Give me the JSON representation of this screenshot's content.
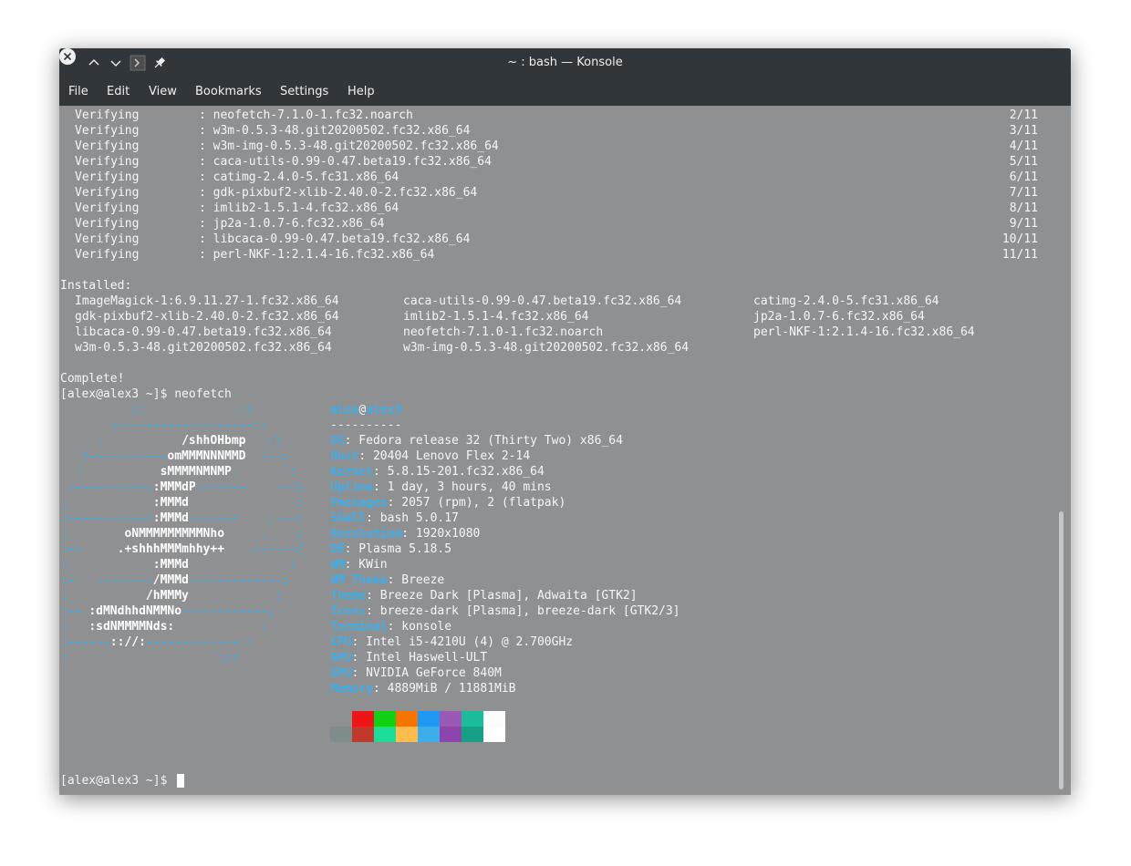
{
  "window": {
    "title": "~ : bash — Konsole"
  },
  "titlebar_icons": [
    "close-icon",
    "minimize-icon",
    "maximize-icon",
    "konsole-app-icon",
    "pin-icon"
  ],
  "menu": [
    "File",
    "Edit",
    "View",
    "Bookmarks",
    "Settings",
    "Help"
  ],
  "verifying": [
    {
      "label": "Verifying",
      "pkg": ": neofetch-7.1.0-1.fc32.noarch",
      "count": "2/11"
    },
    {
      "label": "Verifying",
      "pkg": ": w3m-0.5.3-48.git20200502.fc32.x86_64",
      "count": "3/11"
    },
    {
      "label": "Verifying",
      "pkg": ": w3m-img-0.5.3-48.git20200502.fc32.x86_64",
      "count": "4/11"
    },
    {
      "label": "Verifying",
      "pkg": ": caca-utils-0.99-0.47.beta19.fc32.x86_64",
      "count": "5/11"
    },
    {
      "label": "Verifying",
      "pkg": ": catimg-2.4.0-5.fc31.x86_64",
      "count": "6/11"
    },
    {
      "label": "Verifying",
      "pkg": ": gdk-pixbuf2-xlib-2.40.0-2.fc32.x86_64",
      "count": "7/11"
    },
    {
      "label": "Verifying",
      "pkg": ": imlib2-1.5.1-4.fc32.x86_64",
      "count": "8/11"
    },
    {
      "label": "Verifying",
      "pkg": ": jp2a-1.0.7-6.fc32.x86_64",
      "count": "9/11"
    },
    {
      "label": "Verifying",
      "pkg": ": libcaca-0.99-0.47.beta19.fc32.x86_64",
      "count": "10/11"
    },
    {
      "label": "Verifying",
      "pkg": ": perl-NKF-1:2.1.4-16.fc32.x86_64",
      "count": "11/11"
    }
  ],
  "installed_header": "Installed:",
  "installed": [
    [
      "ImageMagick-1:6.9.11.27-1.fc32.x86_64",
      "caca-utils-0.99-0.47.beta19.fc32.x86_64",
      "catimg-2.4.0-5.fc31.x86_64"
    ],
    [
      "gdk-pixbuf2-xlib-2.40.0-2.fc32.x86_64",
      "imlib2-1.5.1-4.fc32.x86_64",
      "jp2a-1.0.7-6.fc32.x86_64"
    ],
    [
      "libcaca-0.99-0.47.beta19.fc32.x86_64",
      "neofetch-7.1.0-1.fc32.noarch",
      "perl-NKF-1:2.1.4-16.fc32.x86_64"
    ],
    [
      "w3m-0.5.3-48.git20200502.fc32.x86_64",
      "w3m-img-0.5.3-48.git20200502.fc32.x86_64",
      ""
    ]
  ],
  "complete": "Complete!",
  "prompt1": "[alex@alex3 ~]$ neofetch",
  "logo": [
    [
      [
        "f",
        "          /:-------------:\\"
      ]
    ],
    [
      [
        "f",
        "       :-------------------::"
      ]
    ],
    [
      [
        "f",
        "     :-----------"
      ],
      [
        "w",
        "/shhOHbmp"
      ],
      [
        "f",
        "---:\\"
      ]
    ],
    [
      [
        "f",
        "   /-----------"
      ],
      [
        "w",
        "omMMMNNNMMD"
      ],
      [
        "f",
        "  ---:"
      ]
    ],
    [
      [
        "f",
        "  :-----------"
      ],
      [
        "w",
        "sMMMMNMNMP"
      ],
      [
        "f",
        ".    ---:"
      ]
    ],
    [
      [
        "f",
        " :-----------"
      ],
      [
        "w",
        ":MMMdP"
      ],
      [
        "f",
        "-------    ---\\"
      ]
    ],
    [
      [
        "f",
        ",------------"
      ],
      [
        "w",
        ":MMMd"
      ],
      [
        "f",
        "--------    ---:"
      ]
    ],
    [
      [
        "f",
        ":------------"
      ],
      [
        "w",
        ":MMMd"
      ],
      [
        "f",
        "-------    .---:"
      ]
    ],
    [
      [
        "f",
        ":----    "
      ],
      [
        "w",
        "oNMMMMMMMMMNho"
      ],
      [
        "f",
        "     .----:"
      ]
    ],
    [
      [
        "f",
        ":--     "
      ],
      [
        "w",
        ".+shhhMMMmhhy++"
      ],
      [
        "f",
        "   .------/"
      ]
    ],
    [
      [
        "f",
        ":-    -------"
      ],
      [
        "w",
        ":MMMd"
      ],
      [
        "f",
        "--------------:"
      ]
    ],
    [
      [
        "f",
        ":-   --------"
      ],
      [
        "w",
        "/MMMd"
      ],
      [
        "f",
        "-------------;"
      ]
    ],
    [
      [
        "f",
        ":-    ------"
      ],
      [
        "w",
        "/hMMMy"
      ],
      [
        "f",
        "------------:"
      ]
    ],
    [
      [
        "f",
        ":-- "
      ],
      [
        "w",
        ":dMNdhhdNMMNo"
      ],
      [
        "f",
        "------------;"
      ]
    ],
    [
      [
        "f",
        ":---"
      ],
      [
        "w",
        ":sdNMMMMNds:"
      ],
      [
        "f",
        "------------:"
      ]
    ],
    [
      [
        "f",
        ":------"
      ],
      [
        "w",
        ":://:"
      ],
      [
        "f",
        "-------------::"
      ]
    ],
    [
      [
        "f",
        ":---------------------://"
      ]
    ]
  ],
  "info": {
    "user": "alex",
    "at": "@",
    "host": "alex3",
    "separator": "----------",
    "rows": [
      {
        "key": "OS",
        "value": ": Fedora release 32 (Thirty Two) x86_64"
      },
      {
        "key": "Host",
        "value": ": 20404 Lenovo Flex 2-14"
      },
      {
        "key": "Kernel",
        "value": ": 5.8.15-201.fc32.x86_64"
      },
      {
        "key": "Uptime",
        "value": ": 1 day, 3 hours, 40 mins"
      },
      {
        "key": "Packages",
        "value": ": 2057 (rpm), 2 (flatpak)"
      },
      {
        "key": "Shell",
        "value": ": bash 5.0.17"
      },
      {
        "key": "Resolution",
        "value": ": 1920x1080"
      },
      {
        "key": "DE",
        "value": ": Plasma 5.18.5"
      },
      {
        "key": "WM",
        "value": ": KWin"
      },
      {
        "key": "WM Theme",
        "value": ": Breeze"
      },
      {
        "key": "Theme",
        "value": ": Breeze Dark [Plasma], Adwaita [GTK2]"
      },
      {
        "key": "Icons",
        "value": ": breeze-dark [Plasma], breeze-dark [GTK2/3]"
      },
      {
        "key": "Terminal",
        "value": ": konsole"
      },
      {
        "key": "CPU",
        "value": ": Intel i5-4210U (4) @ 2.700GHz"
      },
      {
        "key": "GPU",
        "value": ": Intel Haswell-ULT"
      },
      {
        "key": "GPU",
        "value": ": NVIDIA GeForce 840M"
      },
      {
        "key": "Memory",
        "value": ": 4889MiB / 11881MiB"
      }
    ]
  },
  "palette_top": [
    "#8f9091",
    "#ed1515",
    "#11d116",
    "#f67400",
    "#1d99f3",
    "#9b59b6",
    "#1abc9c",
    "#fcfcfc"
  ],
  "palette_bottom": [
    "#7f8c8d",
    "#c0392b",
    "#1cdc9a",
    "#fdbc4b",
    "#3daee9",
    "#8e44ad",
    "#16a085",
    "#ffffff"
  ],
  "prompt2": "[alex@alex3 ~]$ "
}
